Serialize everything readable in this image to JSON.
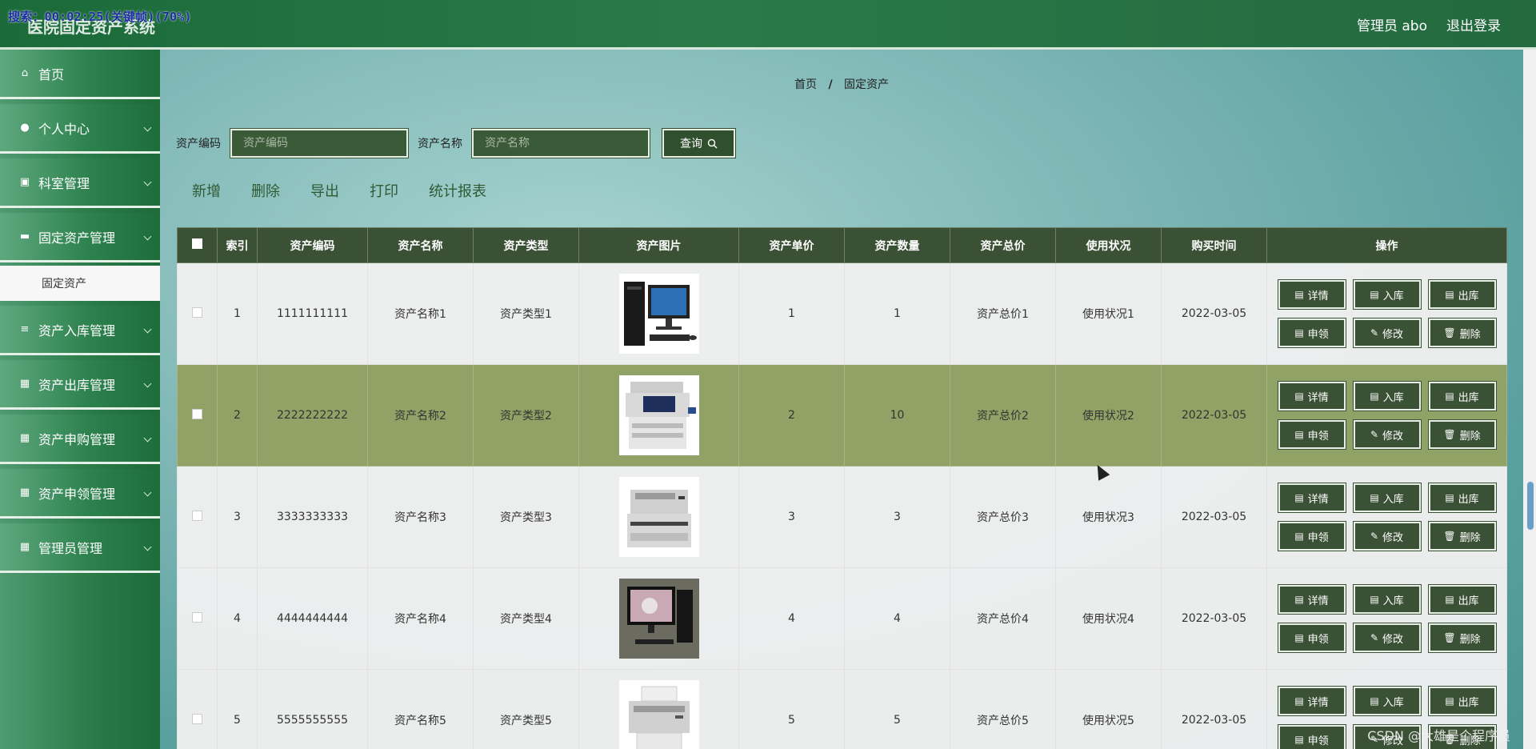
{
  "overlay": {
    "text": "搜索：00:02:25(关键帧)(70%)"
  },
  "app": {
    "title": "医院固定资产系统"
  },
  "header": {
    "admin_label": "管理员 abo",
    "logout_label": "退出登录"
  },
  "sidebar": {
    "items": [
      {
        "label": "首页",
        "icon": "home-icon",
        "glyph": "⌂"
      },
      {
        "label": "个人中心",
        "icon": "user-icon",
        "glyph": "●"
      },
      {
        "label": "科室管理",
        "icon": "clipboard-icon",
        "glyph": "▣"
      },
      {
        "label": "固定资产管理",
        "icon": "box-icon",
        "glyph": "▬"
      },
      {
        "label": "固定资产",
        "icon": "",
        "glyph": ""
      },
      {
        "label": "资产入库管理",
        "icon": "list-icon",
        "glyph": "≡"
      },
      {
        "label": "资产出库管理",
        "icon": "grid-icon",
        "glyph": "▦"
      },
      {
        "label": "资产申购管理",
        "icon": "grid-icon",
        "glyph": "▦"
      },
      {
        "label": "资产申领管理",
        "icon": "grid-icon",
        "glyph": "▦"
      },
      {
        "label": "管理员管理",
        "icon": "grid-icon",
        "glyph": "▦"
      }
    ]
  },
  "breadcrumb": {
    "home": "首页",
    "sep": "/",
    "current": "固定资产"
  },
  "search": {
    "code_label": "资产编码",
    "code_placeholder": "资产编码",
    "name_label": "资产名称",
    "name_placeholder": "资产名称",
    "query_label": "查询"
  },
  "toolbar": {
    "add": "新增",
    "delete": "删除",
    "export": "导出",
    "print": "打印",
    "report": "统计报表"
  },
  "table": {
    "headers": [
      "索引",
      "资产编码",
      "资产名称",
      "资产类型",
      "资产图片",
      "资产单价",
      "资产数量",
      "资产总价",
      "使用状况",
      "购买时间",
      "操作"
    ],
    "rows": [
      {
        "index": "1",
        "code": "1111111111",
        "name": "资产名称1",
        "type": "资产类型1",
        "image": "desktop-computer",
        "price": "1",
        "qty": "1",
        "total": "资产总价1",
        "status": "使用状况1",
        "date": "2022-03-05"
      },
      {
        "index": "2",
        "code": "2222222222",
        "name": "资产名称2",
        "type": "资产类型2",
        "image": "copier",
        "price": "2",
        "qty": "10",
        "total": "资产总价2",
        "status": "使用状况2",
        "date": "2022-03-05"
      },
      {
        "index": "3",
        "code": "3333333333",
        "name": "资产名称3",
        "type": "资产类型3",
        "image": "laser-printer",
        "price": "3",
        "qty": "3",
        "total": "资产总价3",
        "status": "使用状况3",
        "date": "2022-03-05"
      },
      {
        "index": "4",
        "code": "4444444444",
        "name": "资产名称4",
        "type": "资产类型4",
        "image": "computer-monitor",
        "price": "4",
        "qty": "4",
        "total": "资产总价4",
        "status": "使用状况4",
        "date": "2022-03-05"
      },
      {
        "index": "5",
        "code": "5555555555",
        "name": "资产名称5",
        "type": "资产类型5",
        "image": "inkjet-printer",
        "price": "5",
        "qty": "5",
        "total": "资产总价5",
        "status": "使用状况5",
        "date": "2022-03-05"
      }
    ],
    "actions": [
      {
        "label": "详情",
        "icon": "document-icon",
        "glyph": "▤"
      },
      {
        "label": "入库",
        "icon": "document-icon",
        "glyph": "▤"
      },
      {
        "label": "出库",
        "icon": "document-icon",
        "glyph": "▤"
      },
      {
        "label": "申领",
        "icon": "document-icon",
        "glyph": "▤"
      },
      {
        "label": "修改",
        "icon": "edit-icon",
        "glyph": "✎"
      },
      {
        "label": "删除",
        "icon": "trash-icon",
        "glyph": "🗑"
      }
    ]
  },
  "watermark": {
    "text": "CSDN @大雄是个程序员"
  },
  "colors": {
    "brand_green": "#1b6b3a",
    "button_dark": "#3b5135",
    "highlight_row": "#91a266"
  }
}
